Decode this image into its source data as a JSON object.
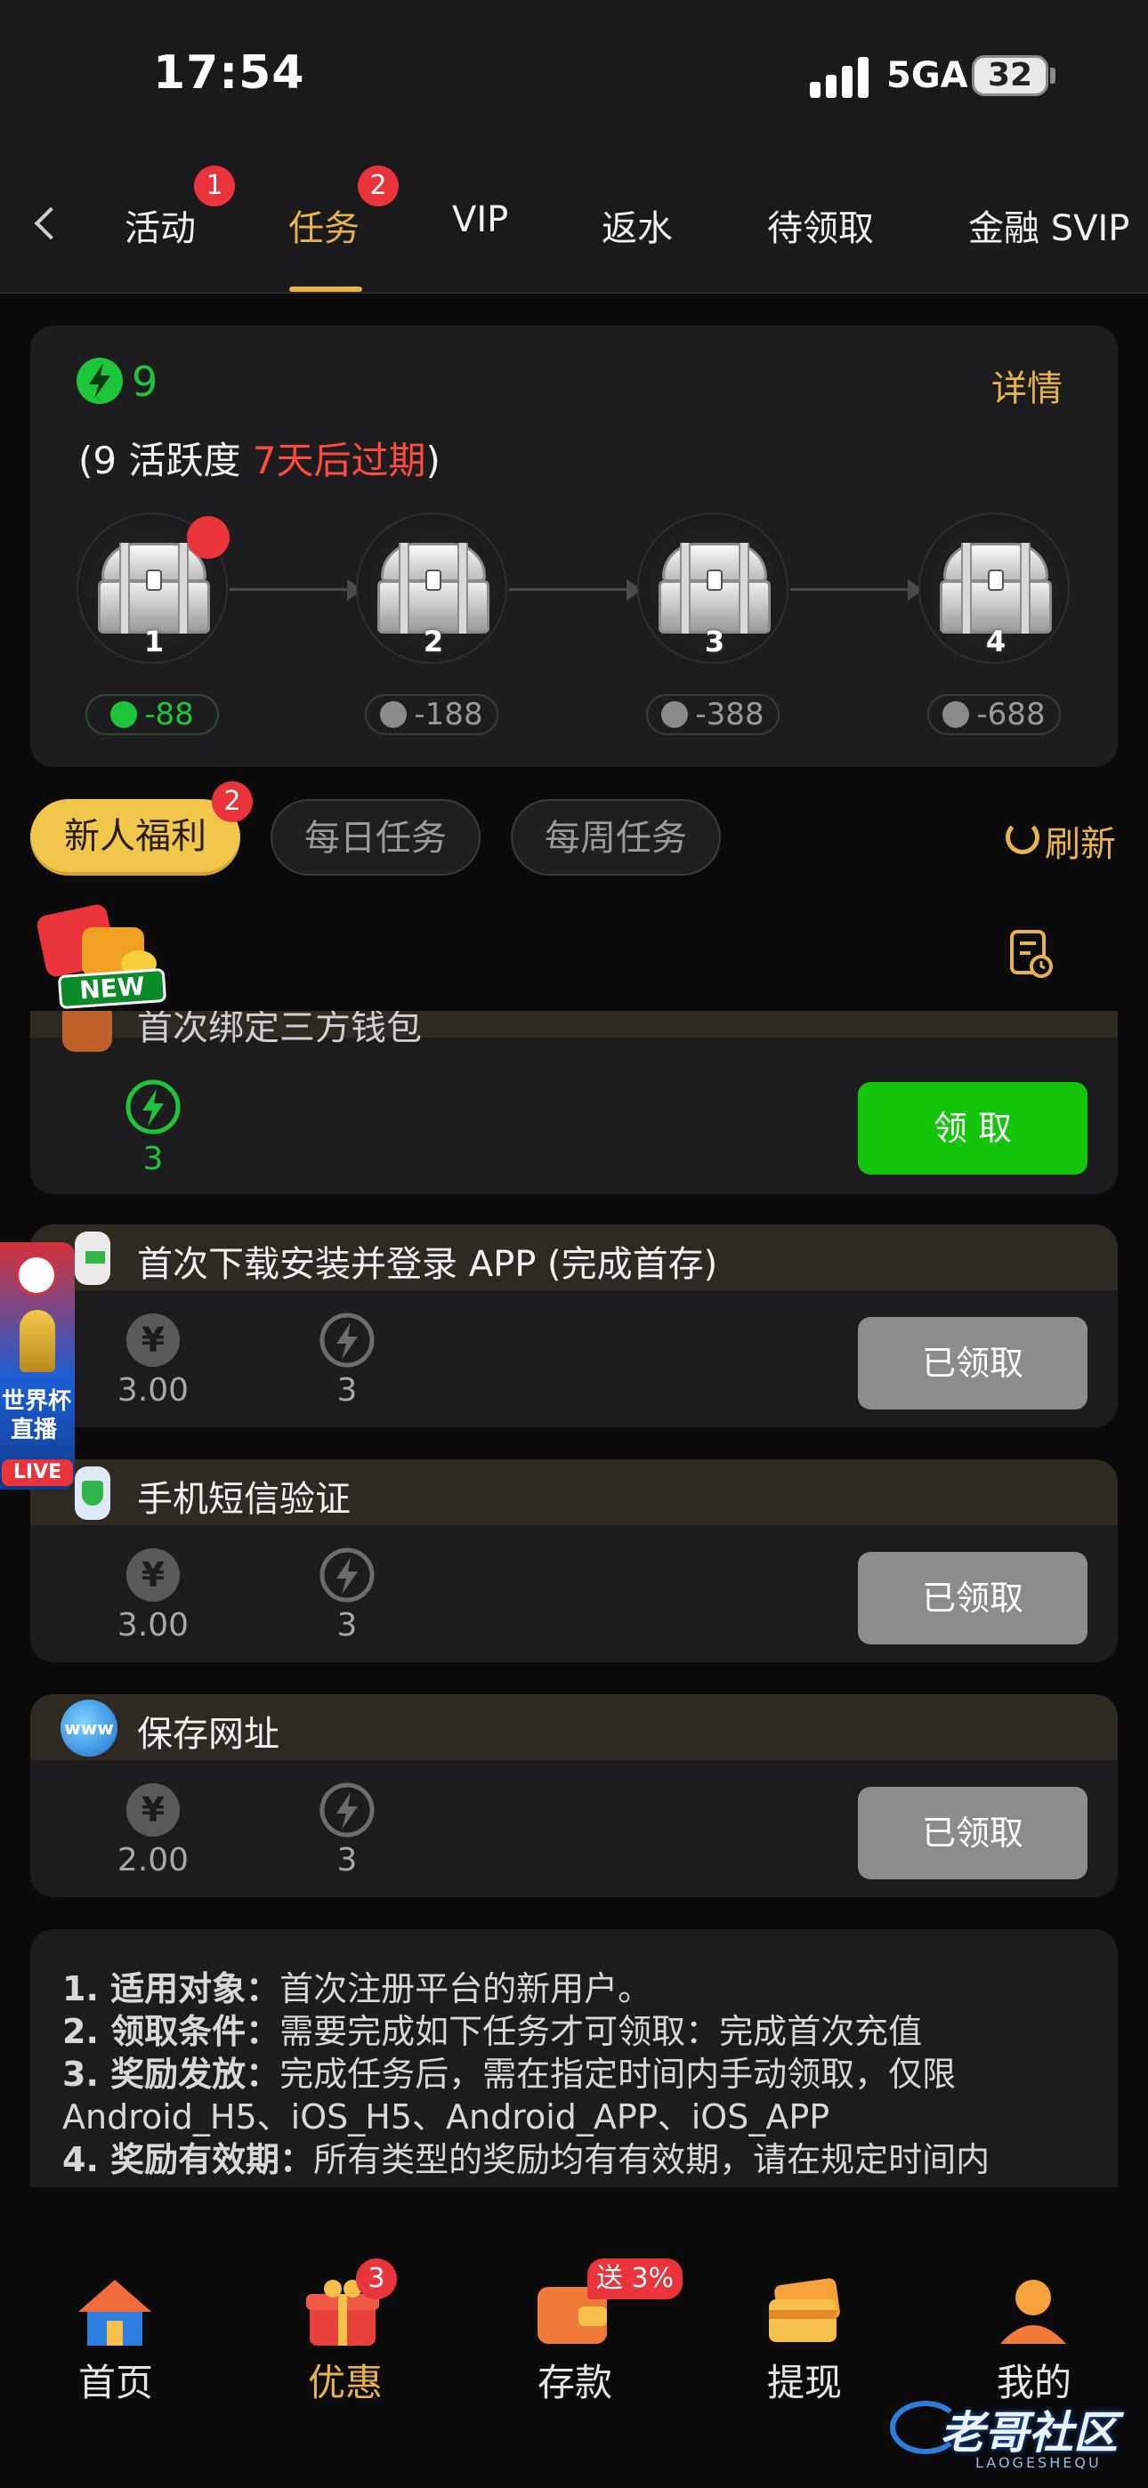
{
  "status": {
    "time": "17:54",
    "network": "5GA",
    "battery": "32"
  },
  "tabs": [
    {
      "label": "活动",
      "badge": "1"
    },
    {
      "label": "任务",
      "badge": "2"
    },
    {
      "label": "VIP"
    },
    {
      "label": "返水"
    },
    {
      "label": "待领取"
    },
    {
      "label": "金融 SVIP"
    }
  ],
  "summary": {
    "points": "9",
    "details_label": "详情",
    "activity_prefix": "(9 活跃度 ",
    "activity_expire": "7天后过期",
    "activity_suffix": ")",
    "chests": [
      {
        "num": "1",
        "cost": "-88",
        "unlocked": true
      },
      {
        "num": "2",
        "cost": "-188",
        "unlocked": false
      },
      {
        "num": "3",
        "cost": "-388",
        "unlocked": false
      },
      {
        "num": "4",
        "cost": "-688",
        "unlocked": false
      }
    ]
  },
  "categories": [
    {
      "label": "新人福利",
      "badge": "2",
      "active": true
    },
    {
      "label": "每日任务",
      "active": false
    },
    {
      "label": "每周任务",
      "active": false
    }
  ],
  "refresh_label": "刷新",
  "new_tag": "NEW",
  "tasks": [
    {
      "title": "首次绑定三方钱包",
      "reward_points": "3",
      "button": "领 取",
      "state": "claim"
    },
    {
      "title": "首次下载安装并登录 APP (完成首存)",
      "reward_money": "3.00",
      "reward_points": "3",
      "button": "已领取",
      "state": "done"
    },
    {
      "title": "手机短信验证",
      "reward_money": "3.00",
      "reward_points": "3",
      "button": "已领取",
      "state": "done"
    },
    {
      "title": "保存网址",
      "reward_money": "2.00",
      "reward_points": "3",
      "button": "已领取",
      "state": "done",
      "icon_text": "www"
    }
  ],
  "rules": [
    {
      "label": "1. 适用对象：",
      "text": "首次注册平台的新用户。"
    },
    {
      "label": "2. 领取条件：",
      "text": "需要完成如下任务才可领取：完成首次充值"
    },
    {
      "label": "3. 奖励发放：",
      "text": "完成任务后，需在指定时间内手动领取，仅限"
    },
    {
      "label": "",
      "text": "Android_H5、iOS_H5、Android_APP、iOS_APP"
    },
    {
      "label": "4. 奖励有效期：",
      "text": "所有类型的奖励均有有效期，请在规定时间内"
    }
  ],
  "float_world": {
    "line1": "世界杯",
    "line2": "直播",
    "live": "LIVE"
  },
  "bottom_nav": [
    {
      "label": "首页"
    },
    {
      "label": "优惠",
      "badge": "3",
      "active": true
    },
    {
      "label": "存款",
      "badge": "送 3%"
    },
    {
      "label": "提现"
    },
    {
      "label": "我的"
    }
  ],
  "watermark": "老哥社区",
  "watermark_sub": "LAOGESHEQU",
  "currency_symbol": "¥",
  "colors": {
    "accent": "#e8b44a",
    "green": "#1ec53a",
    "red": "#e8343a"
  }
}
